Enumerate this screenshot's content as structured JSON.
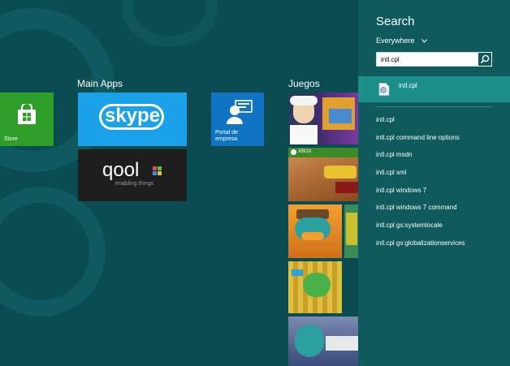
{
  "start": {
    "groups": [
      {
        "label": "Main Apps"
      },
      {
        "label": "Juegos"
      }
    ],
    "tiles": {
      "store": {
        "label": "Store",
        "color": "#2e9e2a"
      },
      "skype": {
        "label": "skype",
        "color": "#1aa1e8"
      },
      "qool": {
        "label": "qool",
        "tagline": "enabling things",
        "color": "#1e1e1e"
      },
      "portal": {
        "label": "Portal de empresa",
        "color": "#1173c4"
      },
      "xbox_badge": "XBOX"
    }
  },
  "search": {
    "title": "Search",
    "scope": "Everywhere",
    "query": "intl.cpl",
    "app_result": "intl.cpl",
    "suggestions": [
      "intl.cpl",
      "intl.cpl command line options",
      "intl.cpl msdn",
      "intl.cpl xml",
      "intl.cpl windows 7",
      "intl.cpl windows 7 command",
      "intl.cpl gs:systemlocale",
      "intl.cpl gs:globalizationservices"
    ]
  }
}
